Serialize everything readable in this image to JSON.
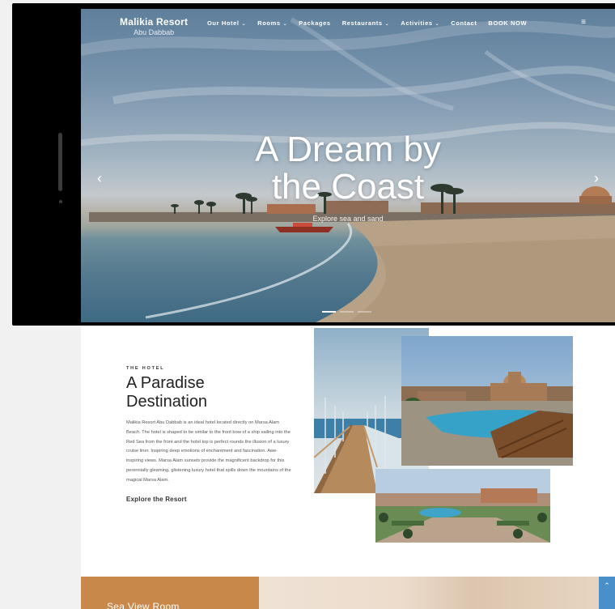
{
  "brand": {
    "name": "Malikia Resort",
    "sub": "Abu Dabbab"
  },
  "nav": {
    "items": [
      {
        "label": "Our Hotel",
        "has_dropdown": true
      },
      {
        "label": "Rooms",
        "has_dropdown": true
      },
      {
        "label": "Packages",
        "has_dropdown": false
      },
      {
        "label": "Restaurants",
        "has_dropdown": true
      },
      {
        "label": "Activities",
        "has_dropdown": true
      },
      {
        "label": "Contact",
        "has_dropdown": false
      },
      {
        "label": "BOOK NOW",
        "has_dropdown": false
      }
    ],
    "dropdown_glyph": "⌄",
    "menu_icon": "hamburger-icon",
    "menu_glyph": "≡"
  },
  "hero": {
    "title_line1": "A Dream by",
    "title_line2": "the Coast",
    "subtitle": "Explore sea and sand",
    "prev_glyph": "‹",
    "next_glyph": "›",
    "slides_total": 3,
    "slide_active": 1
  },
  "intro": {
    "kicker": "THE HOTEL",
    "title_line1": "A Paradise",
    "title_line2": "Destination",
    "body": "Malikia Resort Abu Dabbab is an ideal hotel located directly on Marsa Alam Beach. The hotel is shaped to be similar to the front bow of a ship sailing into the Red Sea from the front and the hotel top is perfect rounds the illusion of a luxury cruise liner. Inspiring deep emotions of enchantment and fascination. Awe-inspiring views. Marsa Alam sunsets provide the magnificent backdrop for this perennially gleaming, glistening luxury hotel that spills down the mountains of the magical Marsa Alam.",
    "link": "Explore the Resort"
  },
  "room_strip": {
    "title": "Sea View Room"
  },
  "scroll_top": {
    "glyph": "⌃"
  },
  "colors": {
    "accent_orange": "#c8884a",
    "scroll_button": "#4a90c8",
    "text_dark": "#222222"
  }
}
